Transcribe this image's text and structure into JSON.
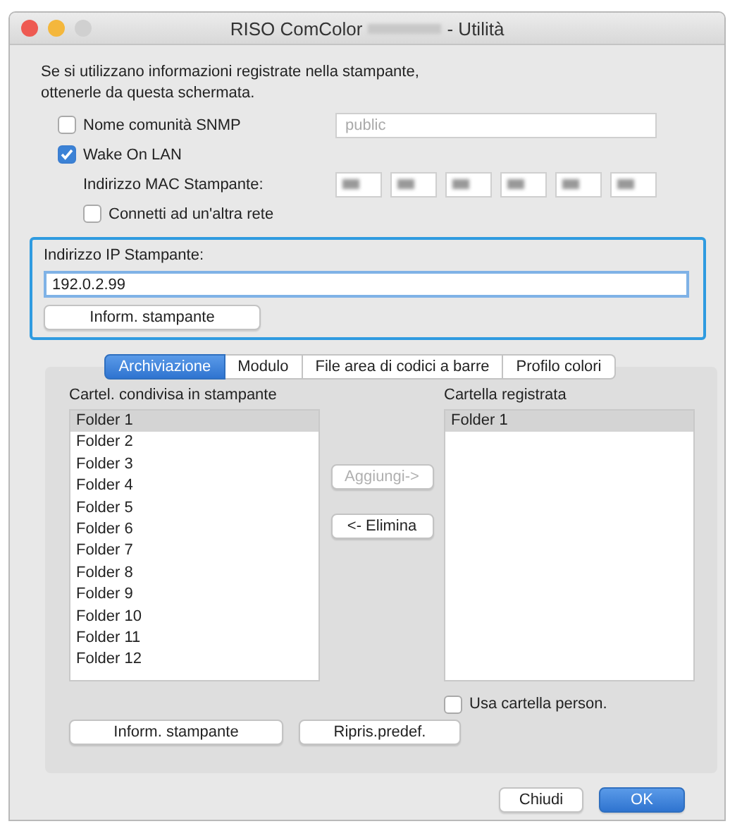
{
  "window": {
    "title_start": "RISO ComColor",
    "title_end": "- Utilità"
  },
  "intro": "Se si utilizzano informazioni registrate nella stampante,\nottenerle da questa schermata.",
  "snmp": {
    "label": "Nome comunità SNMP",
    "checked": false,
    "placeholder": "public"
  },
  "wake_on_lan": {
    "label": "Wake On LAN",
    "checked": true
  },
  "mac": {
    "label": "Indirizzo MAC Stampante:"
  },
  "other_network": {
    "label": "Connetti ad un'altra rete",
    "checked": false
  },
  "ip": {
    "label": "Indirizzo IP Stampante:",
    "value": "192.0.2.99",
    "button": "Inform. stampante"
  },
  "tabs": [
    {
      "label": "Archiviazione",
      "selected": true
    },
    {
      "label": "Modulo",
      "selected": false
    },
    {
      "label": "File area di codici a barre",
      "selected": false
    },
    {
      "label": "Profilo colori",
      "selected": false
    }
  ],
  "shared_folders": {
    "title": "Cartel. condivisa in stampante",
    "items": [
      {
        "label": "Folder 1",
        "selected": true
      },
      {
        "label": "Folder 2",
        "selected": false
      },
      {
        "label": "Folder 3",
        "selected": false
      },
      {
        "label": "Folder 4",
        "selected": false
      },
      {
        "label": "Folder 5",
        "selected": false
      },
      {
        "label": "Folder 6",
        "selected": false
      },
      {
        "label": "Folder 7",
        "selected": false
      },
      {
        "label": "Folder 8",
        "selected": false
      },
      {
        "label": "Folder 9",
        "selected": false
      },
      {
        "label": "Folder 10",
        "selected": false
      },
      {
        "label": "Folder 11",
        "selected": false
      },
      {
        "label": "Folder 12",
        "selected": false
      }
    ]
  },
  "move_buttons": [
    {
      "label": "Aggiungi->",
      "disabled": true
    },
    {
      "label": "<- Elimina",
      "disabled": false
    }
  ],
  "registered_folders": {
    "title": "Cartella registrata",
    "items": [
      {
        "label": "Folder 1",
        "selected": true
      }
    ]
  },
  "custom_folder": {
    "label": "Usa cartella person.",
    "checked": false
  },
  "panel_buttons": [
    "Inform. stampante",
    "Ripris.predef."
  ],
  "dialog_buttons": [
    {
      "label": "Chiudi",
      "kind": "secondary"
    },
    {
      "label": "OK",
      "kind": "primary"
    }
  ]
}
